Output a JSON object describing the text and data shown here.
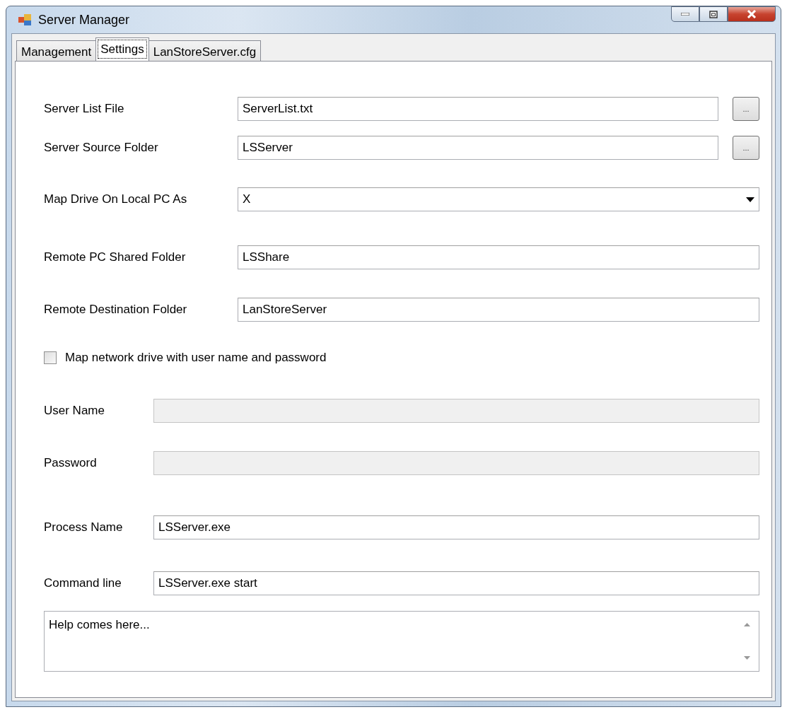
{
  "window": {
    "title": "Server Manager"
  },
  "tabs": [
    {
      "label": "Management",
      "selected": false
    },
    {
      "label": "Settings",
      "selected": true
    },
    {
      "label": "LanStoreServer.cfg",
      "selected": false
    }
  ],
  "path_fields": [
    {
      "label": "Server List File",
      "value": "ServerList.txt",
      "browse": "..."
    },
    {
      "label": "Server Source Folder",
      "value": "LSServer",
      "browse": "..."
    }
  ],
  "drive_field": {
    "label": "Map Drive On Local PC As",
    "value": "X"
  },
  "remote_fields": [
    {
      "label": "Remote PC Shared Folder",
      "value": "LSShare"
    },
    {
      "label": "Remote Destination Folder",
      "value": "LanStoreServer"
    }
  ],
  "credentials_option": {
    "label": "Map network drive with user name and password",
    "checked": false
  },
  "credential_fields": [
    {
      "label": "User Name",
      "disabled": true
    },
    {
      "label": "Password",
      "disabled": true
    }
  ],
  "process_fields": [
    {
      "label": "Process Name",
      "value": "LSServer.exe"
    },
    {
      "label": "Command line",
      "value": "LSServer.exe start"
    }
  ],
  "help": {
    "value": "Help comes here..."
  }
}
